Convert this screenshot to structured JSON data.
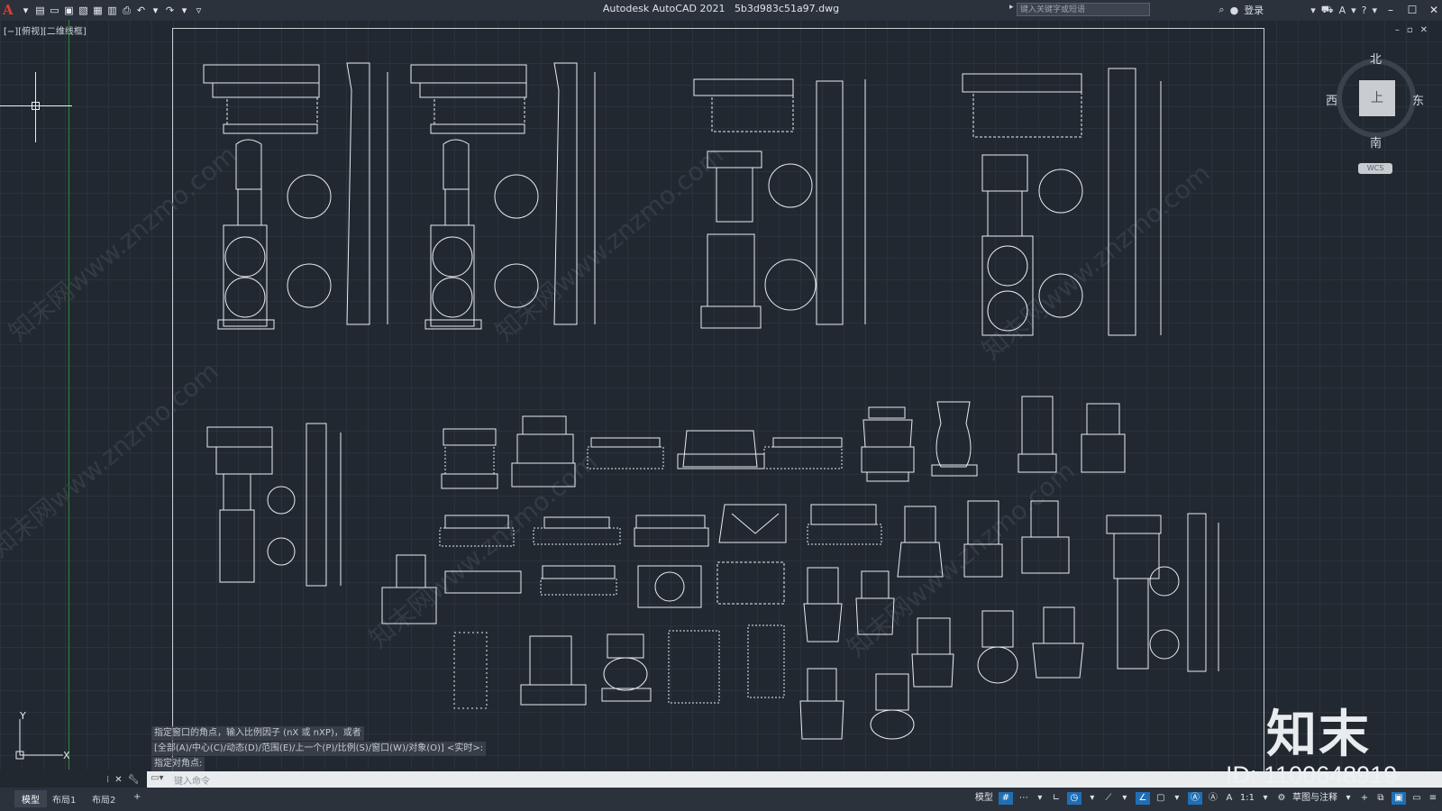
{
  "app": {
    "title": "Autodesk AutoCAD 2021",
    "file": "5b3d983c51a97.dwg"
  },
  "search": {
    "placeholder": "键入关键字或短语"
  },
  "user": {
    "login": "登录"
  },
  "view_label": "[−][俯视][二维线框]",
  "viewcube": {
    "north": "北",
    "south": "南",
    "east": "东",
    "west": "西",
    "face": "上",
    "wcs": "WCS"
  },
  "command": {
    "history": [
      "指定窗口的角点，输入比例因子 (nX 或 nXP)，或者",
      "[全部(A)/中心(C)/动态(D)/范围(E)/上一个(P)/比例(S)/窗口(W)/对象(O)] <实时>:",
      "指定对角点:"
    ],
    "placeholder": "键入命令"
  },
  "tabs": [
    "模型",
    "布局1",
    "布局2",
    "+"
  ],
  "status": {
    "model": "模型",
    "scale": "1:1",
    "workspace": "草图与注释"
  },
  "watermark": {
    "brand": "知末",
    "id": "ID: 1100648919",
    "site": "知末网www.znzmo.com"
  },
  "colors": {
    "background": "#212830",
    "accent": "#1f6fb5",
    "logo": "#e23a2e"
  }
}
